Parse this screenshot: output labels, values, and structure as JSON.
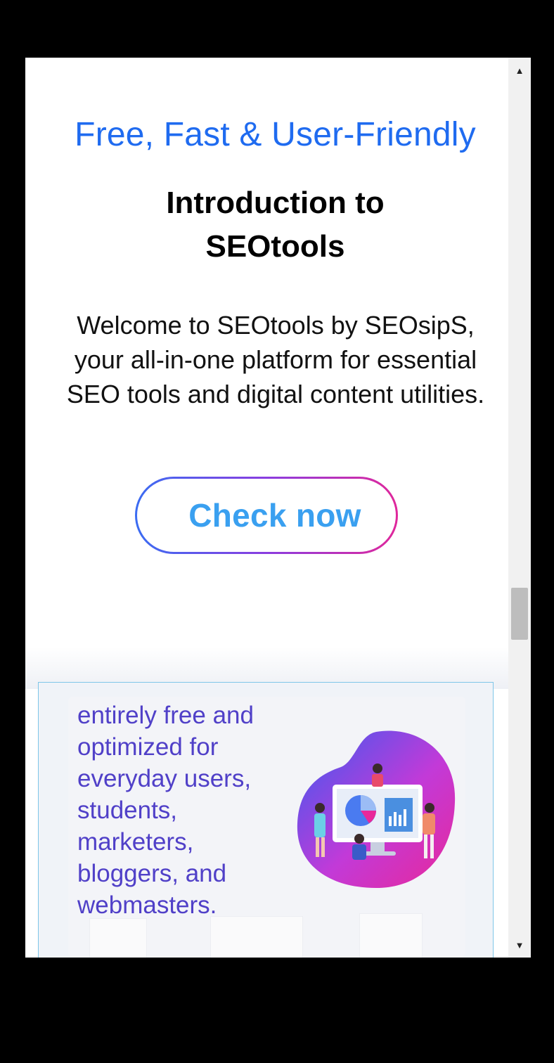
{
  "hero": {
    "tagline": "Free, Fast & User-Friendly",
    "title_line1": "Introduction to",
    "title_line2": "SEOtools",
    "welcome": "Welcome to SEOtools by SEOsipS, your all-in-one platform for essential SEO tools and digital content utilities.",
    "cta_label": "Check now"
  },
  "card": {
    "text": "entirely free and optimized for everyday users, students, marketers, bloggers, and webmasters."
  },
  "scrollbar": {
    "up_icon": "▲",
    "down_icon": "▼",
    "position": 0.6
  },
  "colors": {
    "tagline": "#1f6bf0",
    "cta_text": "#3aa0f0",
    "card_text": "#5040c8",
    "cta_gradient": [
      "#3a6cf2",
      "#8a3de0",
      "#e0279b"
    ],
    "blob_gradient": [
      "#3a5bf0",
      "#c23ad8",
      "#e8289a"
    ]
  }
}
